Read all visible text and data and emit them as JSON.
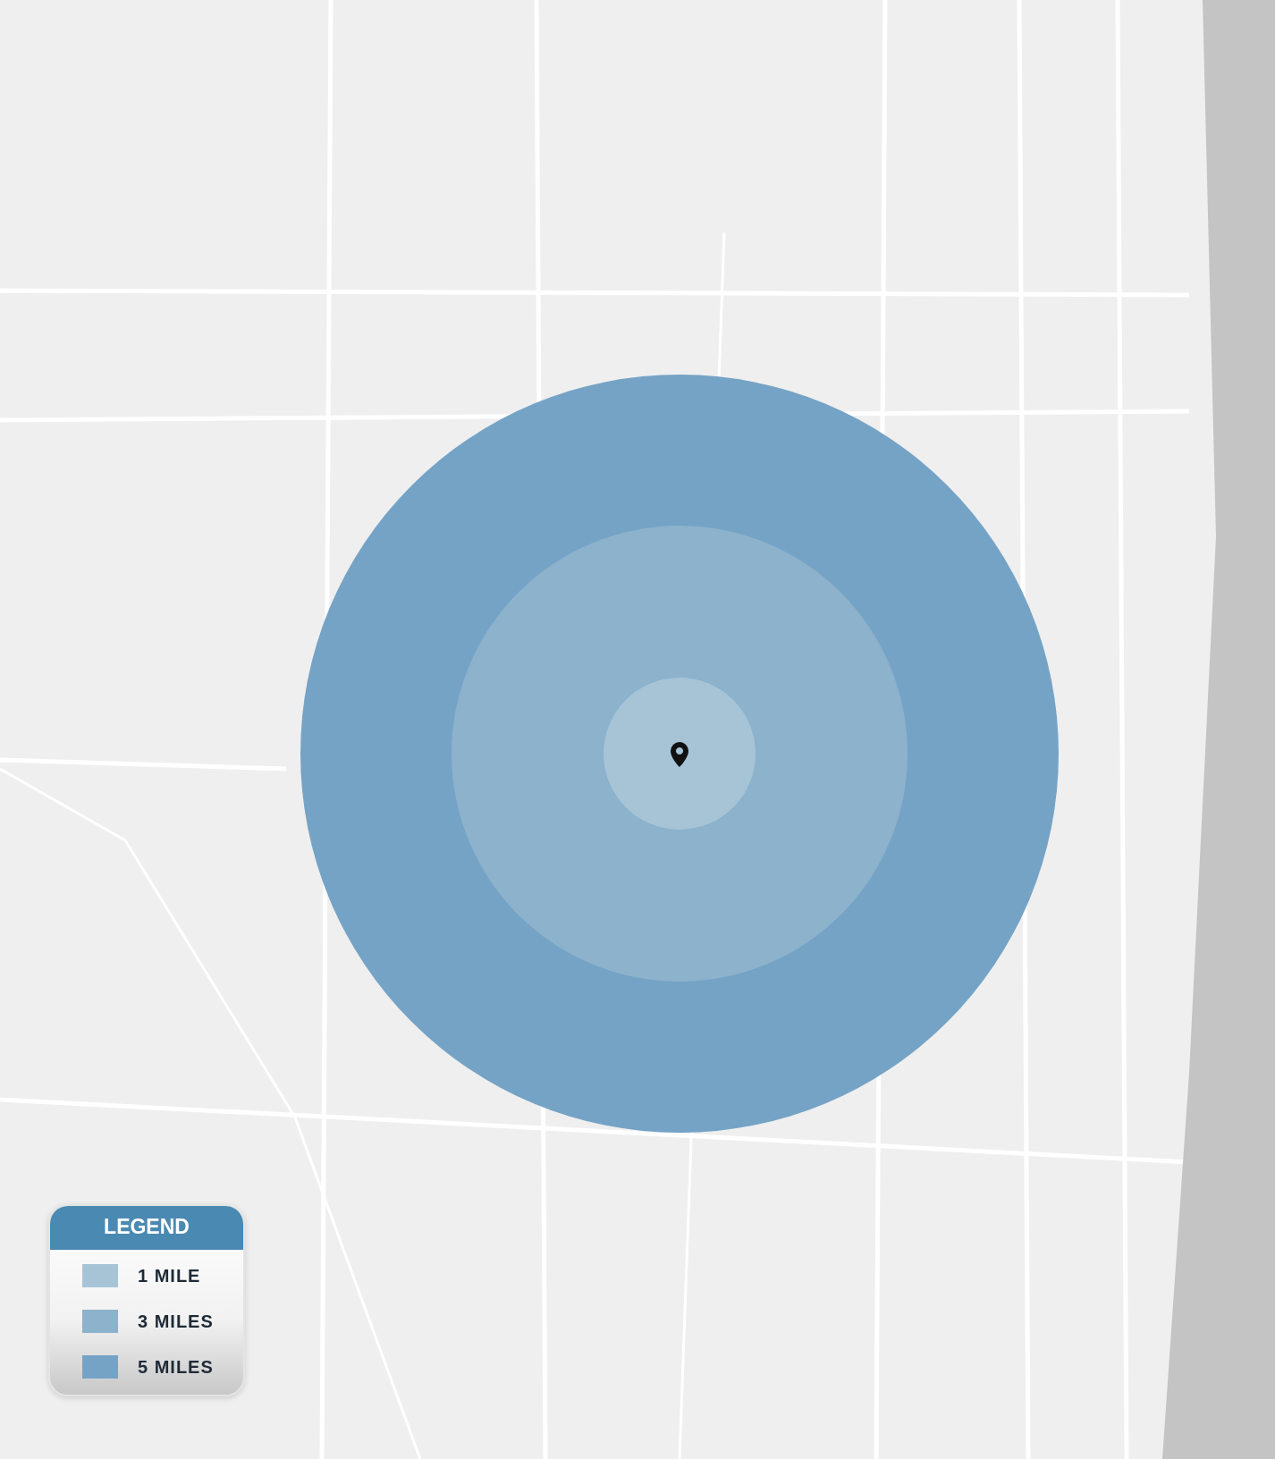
{
  "map": {
    "rings": [
      {
        "label": "1 MILE",
        "color": "#a6c4d6"
      },
      {
        "label": "3 MILES",
        "color": "#8cb2cc"
      },
      {
        "label": "5 MILES",
        "color": "#75a3c6"
      }
    ]
  },
  "legend": {
    "title": "LEGEND"
  }
}
